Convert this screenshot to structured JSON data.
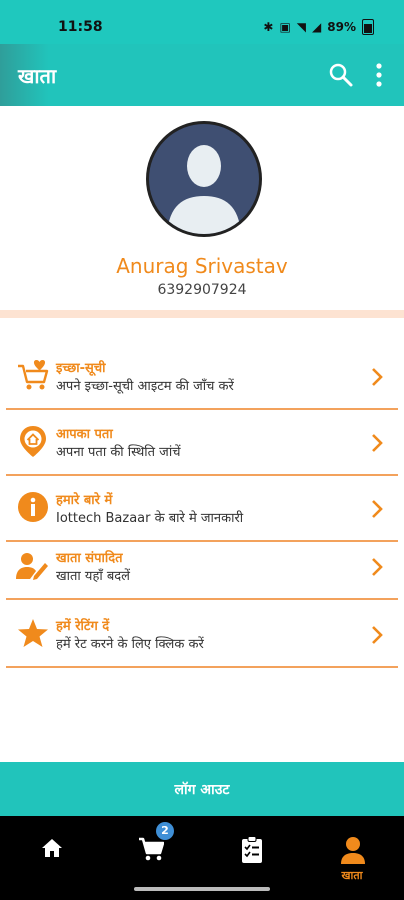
{
  "status": {
    "time": "11:58",
    "battery_text": "89%"
  },
  "app_bar": {
    "title": "खाता",
    "icons": [
      "search-icon",
      "more-vert-icon"
    ]
  },
  "profile": {
    "name": "Anurag Srivastav",
    "phone": "6392907924"
  },
  "menu": [
    {
      "title": "इच्छा-सूची",
      "subtitle": "अपने इच्छा-सूची आइटम की जाँच करें",
      "icon": "wishlist-cart-icon"
    },
    {
      "title": "आपका पता",
      "subtitle": "अपना पता की स्थिति जांचें",
      "icon": "home-pin-icon"
    },
    {
      "title": "हमारे बारे में",
      "subtitle": "Iottech Bazaar के बारे मे जानकारी",
      "icon": "info-icon"
    },
    {
      "title": "खाता संपादित",
      "subtitle": "खाता यहाँ बदलें",
      "icon": "edit-account-icon"
    },
    {
      "title": "हमें रेटिंग दें",
      "subtitle": "हमें रेट करने के लिए क्लिक करें",
      "icon": "star-icon"
    }
  ],
  "logout": {
    "label": "लॉग आउट"
  },
  "bottom_nav": {
    "items": [
      {
        "icon": "home-icon"
      },
      {
        "icon": "cart-icon",
        "badge": "2"
      },
      {
        "icon": "clipboard-icon"
      },
      {
        "icon": "account-icon",
        "label": "खाता"
      }
    ]
  },
  "colors": {
    "primary": "#21c4bb",
    "accent": "#f08a1c",
    "band": "#fde3d2",
    "badge": "#3f8fd6"
  }
}
